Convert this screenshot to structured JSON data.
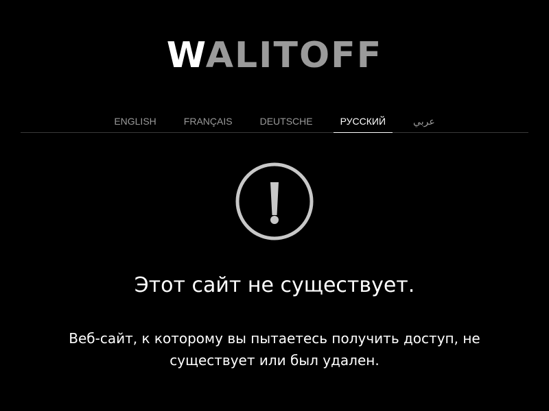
{
  "logo": {
    "first_letter": "W",
    "rest": "ALITOFF"
  },
  "languages": [
    {
      "label": "ENGLISH",
      "active": false
    },
    {
      "label": "FRANÇAIS",
      "active": false
    },
    {
      "label": "DEUTSCHE",
      "active": false
    },
    {
      "label": "РУССКИЙ",
      "active": true
    },
    {
      "label": "عربي",
      "active": false
    }
  ],
  "warning_icon": "exclamation-circle-icon",
  "headline": "Этот сайт не существует.",
  "message_line1": "Веб-сайт, к которому вы пытаетесь получить доступ, не",
  "message_line2": "существует или был удален.",
  "colors": {
    "background": "#000000",
    "logo_accent": "#ffffff",
    "logo_main": "#9a9a9a",
    "nav_inactive": "#9a9a9a",
    "nav_active": "#ffffff",
    "icon": "#c8c8c8"
  }
}
